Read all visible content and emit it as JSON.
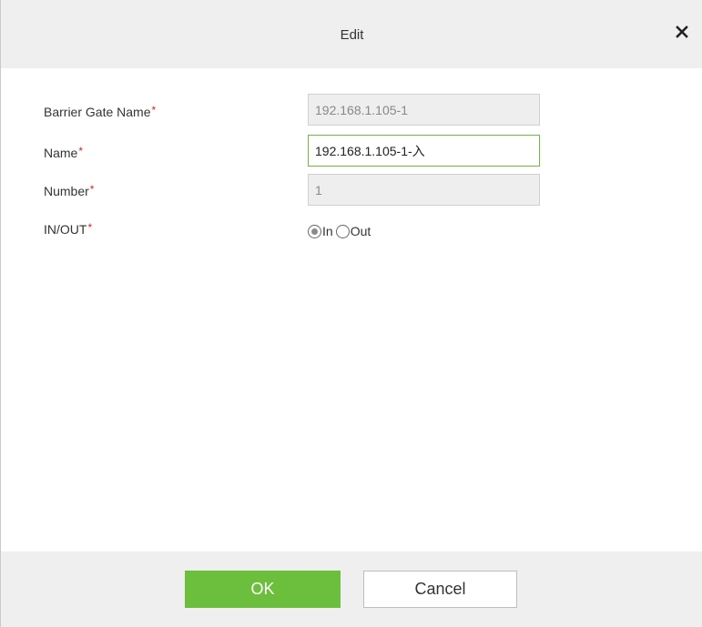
{
  "dialog": {
    "title": "Edit",
    "close_icon": "close-icon"
  },
  "form": {
    "required_marker": "*",
    "barrier_gate_name": {
      "label": "Barrier Gate Name",
      "value": "192.168.1.105-1"
    },
    "name": {
      "label": "Name",
      "value": "192.168.1.105-1-入"
    },
    "number": {
      "label": "Number",
      "value": "1"
    },
    "in_out": {
      "label": "IN/OUT",
      "options": [
        "In",
        "Out"
      ],
      "selected": "In"
    }
  },
  "footer": {
    "ok_label": "OK",
    "cancel_label": "Cancel"
  },
  "colors": {
    "accent": "#6cbf3c",
    "required": "#e02020",
    "header_bg": "#efefef"
  }
}
